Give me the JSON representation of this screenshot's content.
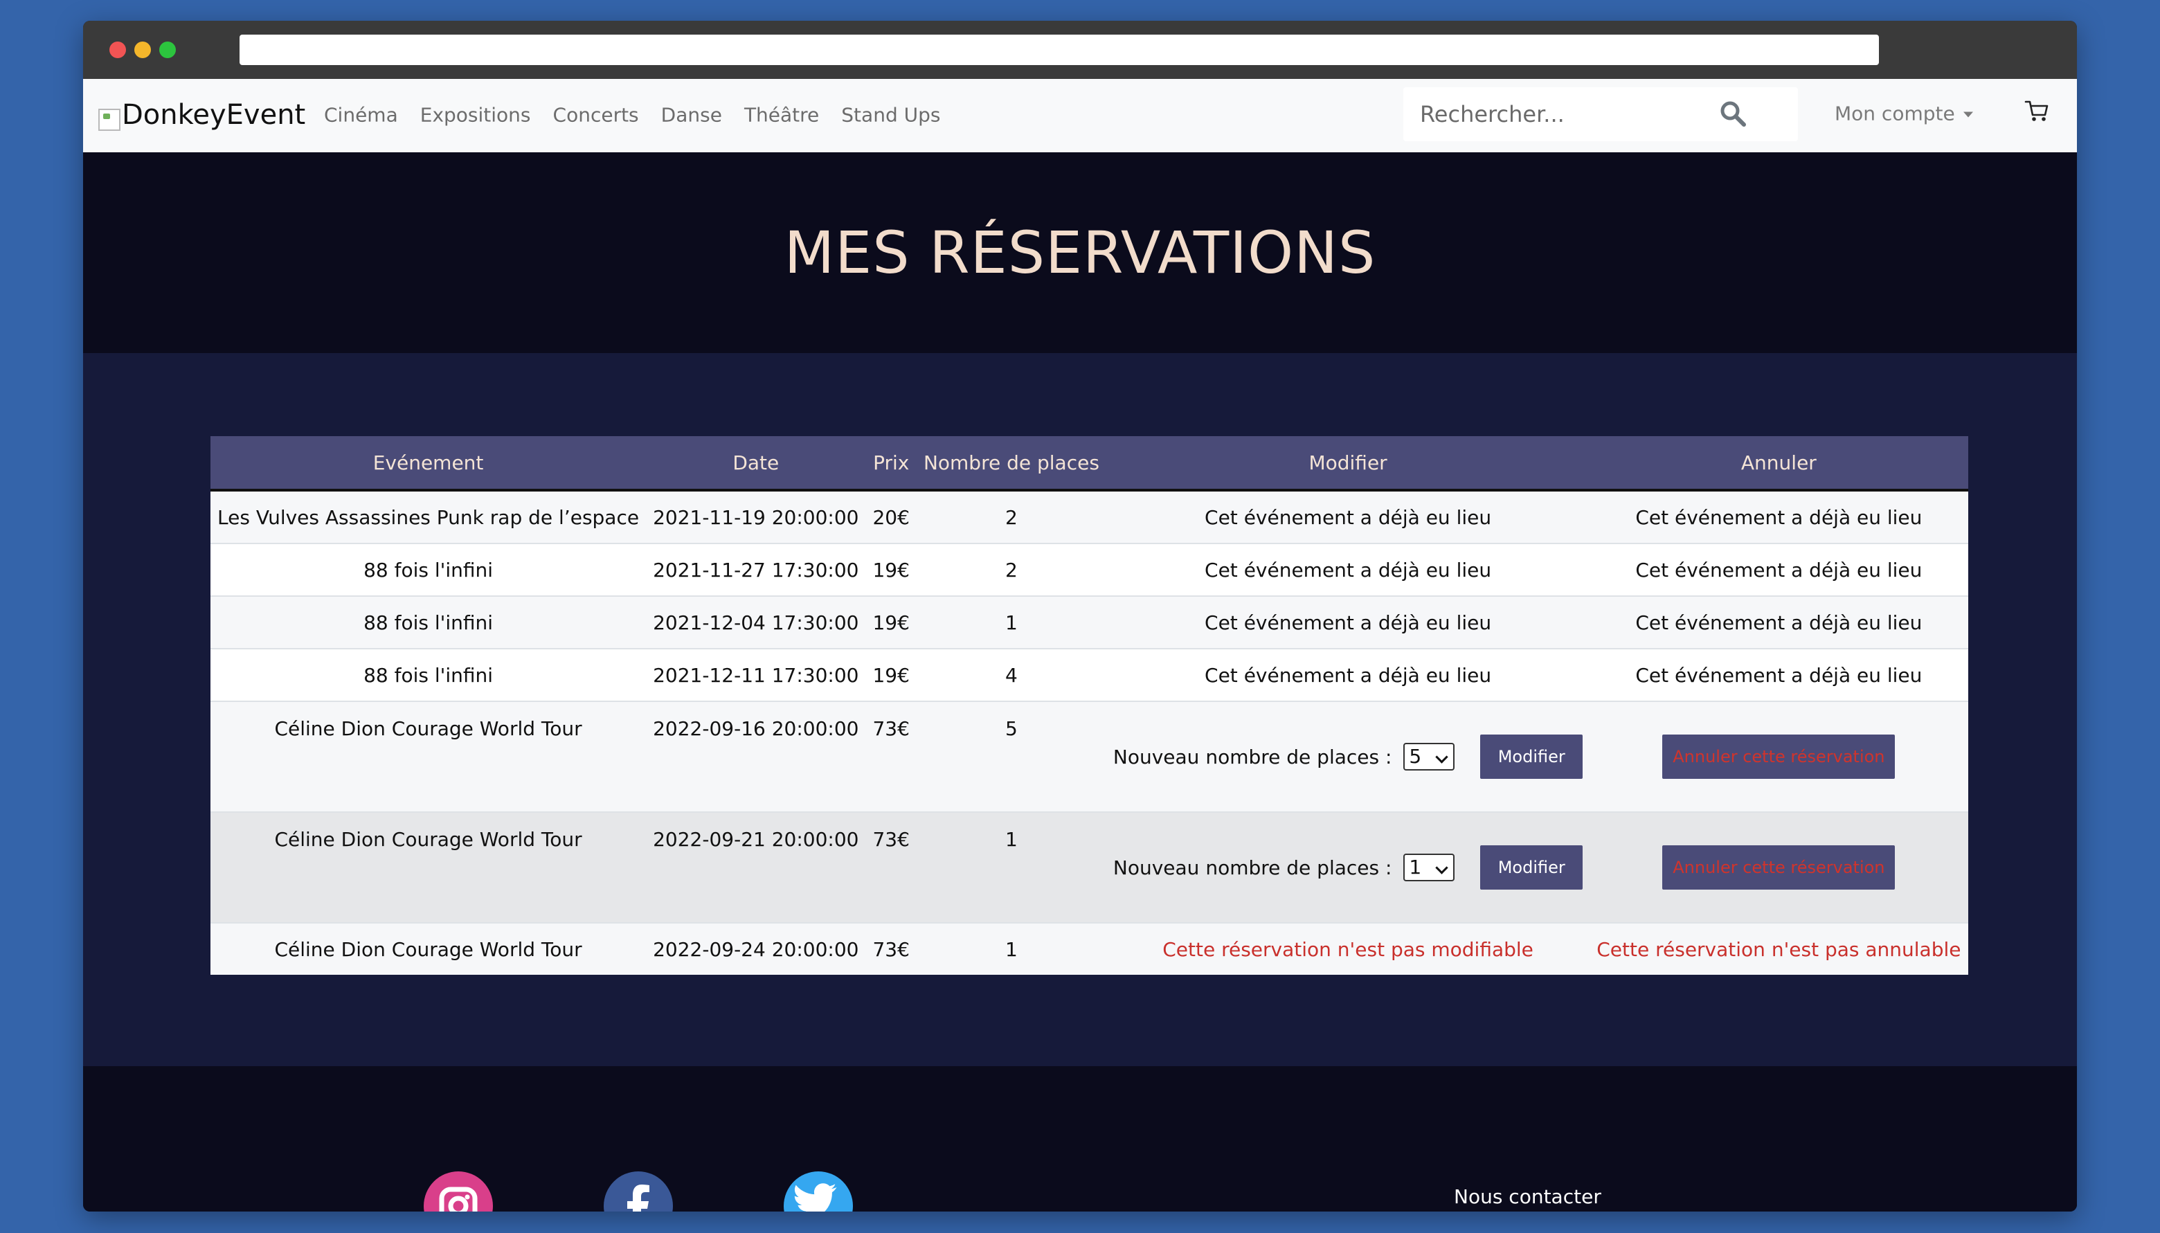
{
  "window": {
    "url": ""
  },
  "navbar": {
    "brand": "DonkeyEvent",
    "links": [
      "Cinéma",
      "Expositions",
      "Concerts",
      "Danse",
      "Théâtre",
      "Stand Ups"
    ],
    "search_placeholder": "Rechercher...",
    "account_label": "Mon compte"
  },
  "hero": {
    "title": "MES RÉSERVATIONS"
  },
  "table": {
    "headers": [
      "Evénement",
      "Date",
      "Prix",
      "Nombre de places",
      "Modifier",
      "Annuler"
    ],
    "rows": [
      {
        "event": "Les Vulves Assassines Punk rap de l’espace",
        "date": "2021-11-19 20:00:00",
        "price": "20€",
        "places": "2",
        "modify": "Cet événement a déjà eu lieu",
        "cancel": "Cet événement a déjà eu lieu"
      },
      {
        "event": "88 fois l'infini",
        "date": "2021-11-27 17:30:00",
        "price": "19€",
        "places": "2",
        "modify": "Cet événement a déjà eu lieu",
        "cancel": "Cet événement a déjà eu lieu"
      },
      {
        "event": "88 fois l'infini",
        "date": "2021-12-04 17:30:00",
        "price": "19€",
        "places": "1",
        "modify": "Cet événement a déjà eu lieu",
        "cancel": "Cet événement a déjà eu lieu"
      },
      {
        "event": "88 fois l'infini",
        "date": "2021-12-11 17:30:00",
        "price": "19€",
        "places": "4",
        "modify": "Cet événement a déjà eu lieu",
        "cancel": "Cet événement a déjà eu lieu"
      },
      {
        "event": "Céline Dion Courage World Tour",
        "date": "2022-09-16 20:00:00",
        "price": "73€",
        "places": "5",
        "new_places_label": "Nouveau nombre de places :",
        "select_value": "5",
        "modify_button": "Modifier",
        "cancel_button": "Annuler cette réservation"
      },
      {
        "event": "Céline Dion Courage World Tour",
        "date": "2022-09-21 20:00:00",
        "price": "73€",
        "places": "1",
        "new_places_label": "Nouveau nombre de places :",
        "select_value": "1",
        "modify_button": "Modifier",
        "cancel_button": "Annuler cette réservation"
      },
      {
        "event": "Céline Dion Courage World Tour",
        "date": "2022-09-24 20:00:00",
        "price": "73€",
        "places": "1",
        "modify": "Cette réservation n'est pas modifiable",
        "cancel": "Cette réservation n'est pas annulable"
      }
    ]
  },
  "footer": {
    "socials": [
      "instagram-icon",
      "facebook-icon",
      "twitter-icon"
    ],
    "contact": "Nous contacter"
  },
  "colors": {
    "page_bg": "#3464aa",
    "navbar_bg": "#f8f9fa",
    "hero_bg": "#0b0b1c",
    "main_bg": "#161a3a",
    "table_header_bg": "#4a4b78",
    "table_header_text": "#f4e4d6",
    "title_color": "#f2dccb",
    "danger": "#c9302c"
  }
}
